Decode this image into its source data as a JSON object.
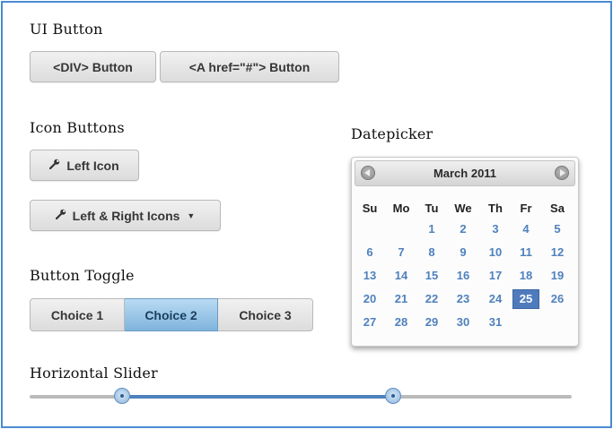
{
  "ui_button": {
    "heading": "UI Button",
    "div_button": "<DIV> Button",
    "a_button": "<A href=\"#\"> Button"
  },
  "icon_buttons": {
    "heading": "Icon Buttons",
    "left_icon_label": "Left Icon",
    "left_right_label": "Left & Right Icons",
    "icon": "wrench-icon",
    "caret": "caret-down-icon"
  },
  "button_toggle": {
    "heading": "Button Toggle",
    "choices": [
      "Choice 1",
      "Choice 2",
      "Choice 3"
    ],
    "active": "Choice 2"
  },
  "datepicker": {
    "heading": "Datepicker",
    "title": "March 2011",
    "days_of_week": [
      "Su",
      "Mo",
      "Tu",
      "We",
      "Th",
      "Fr",
      "Sa"
    ],
    "first_weekday_index": 2,
    "days_in_month": 31,
    "selected_day": "25",
    "nav_prev": "prev-icon",
    "nav_next": "next-icon"
  },
  "horizontal_slider": {
    "heading": "Horizontal Slider",
    "range_low": 0.17,
    "range_high": 0.67
  },
  "colors": {
    "accent": "#4f81bd",
    "toggle_active": "#8fc0e4",
    "frame_border": "#4a8bd3"
  }
}
